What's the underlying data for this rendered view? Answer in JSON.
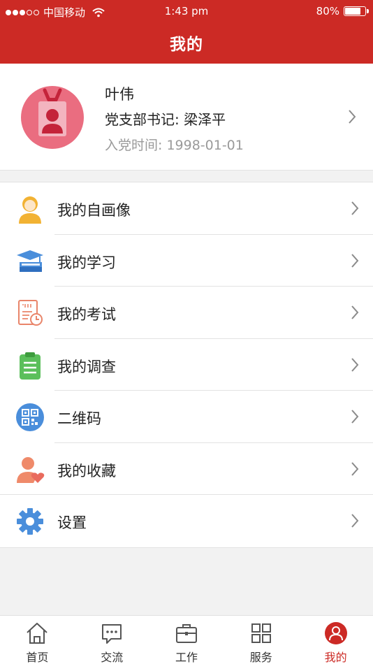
{
  "status_bar": {
    "carrier": "中国移动",
    "time": "1:43 pm",
    "battery_text": "80%",
    "battery_level": 0.8
  },
  "header": {
    "title": "我的"
  },
  "profile": {
    "name": "叶伟",
    "role": "党支部书记: 梁泽平",
    "join_date": "入党时间: 1998-01-01"
  },
  "menu": {
    "items": [
      {
        "label": "我的自画像",
        "icon": "self-portrait-icon"
      },
      {
        "label": "我的学习",
        "icon": "study-book-icon"
      },
      {
        "label": "我的考试",
        "icon": "exam-paper-icon"
      },
      {
        "label": "我的调查",
        "icon": "survey-clipboard-icon"
      },
      {
        "label": "二维码",
        "icon": "qr-code-icon"
      },
      {
        "label": "我的收藏",
        "icon": "favorite-user-icon"
      },
      {
        "label": "设置",
        "icon": "gear-icon"
      }
    ]
  },
  "tabbar": {
    "tabs": [
      {
        "label": "首页",
        "icon": "home-icon"
      },
      {
        "label": "交流",
        "icon": "chat-icon"
      },
      {
        "label": "工作",
        "icon": "briefcase-icon"
      },
      {
        "label": "服务",
        "icon": "grid-icon"
      },
      {
        "label": "我的",
        "icon": "user-circle-icon",
        "active": true
      }
    ]
  },
  "colors": {
    "brand_red": "#cc2a25",
    "avatar_pink": "#ea6d80",
    "secondary_text": "#9a9a9a"
  }
}
